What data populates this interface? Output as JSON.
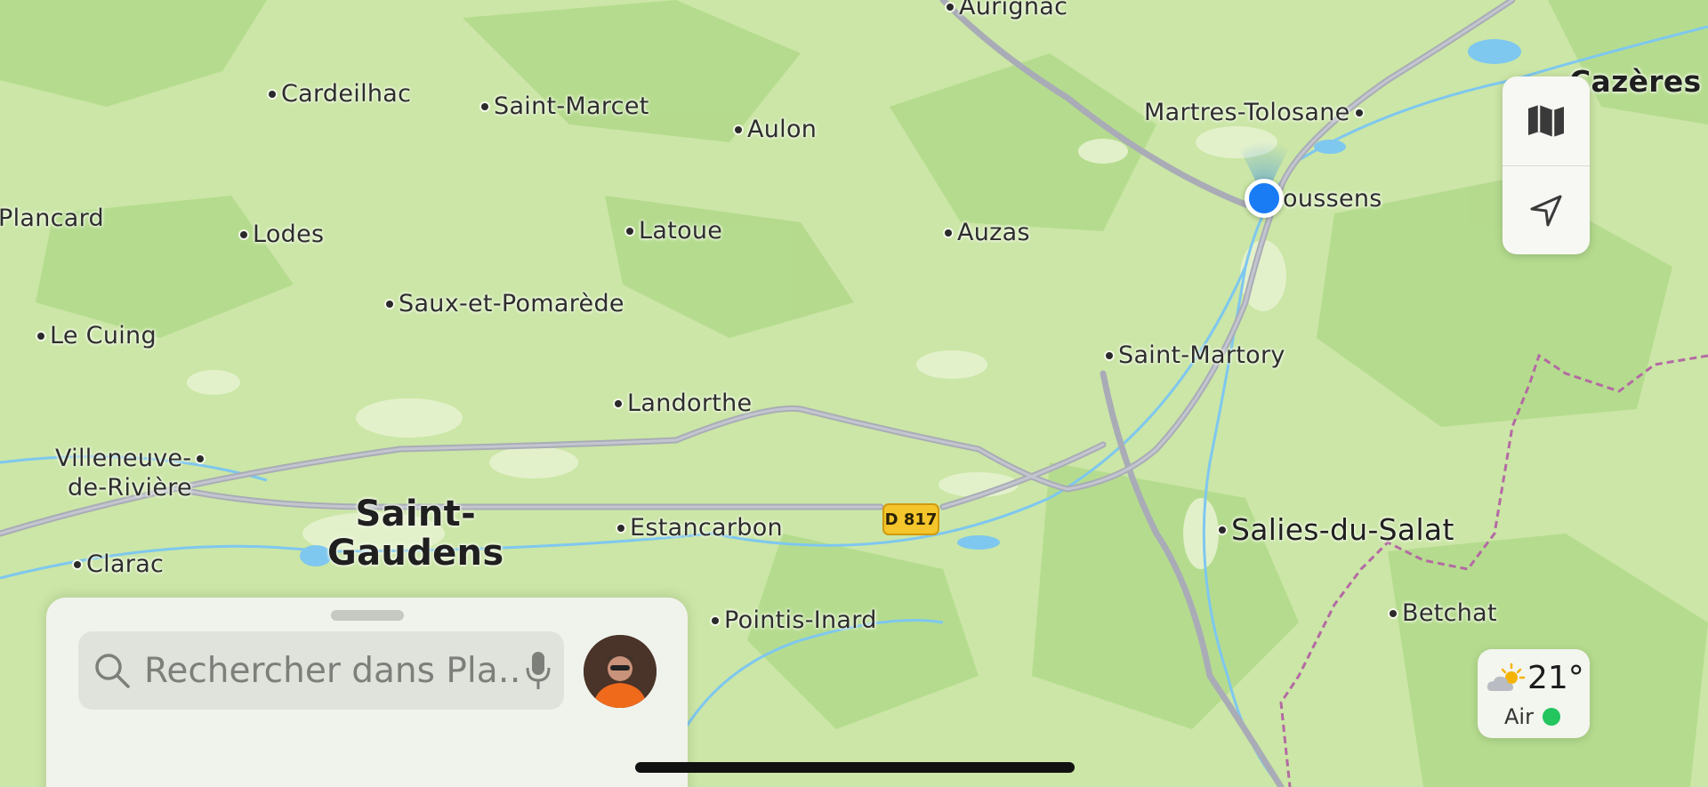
{
  "map": {
    "places": [
      {
        "id": "aurignac",
        "name": "Aurignac"
      },
      {
        "id": "cardeilhac",
        "name": "Cardeilhac"
      },
      {
        "id": "saint-marcet",
        "name": "Saint-Marcet"
      },
      {
        "id": "aulon",
        "name": "Aulon"
      },
      {
        "id": "martres-tolosane",
        "name": "Martres-Tolosane"
      },
      {
        "id": "cazeres",
        "name": "Cazères"
      },
      {
        "id": "plancard",
        "name": "Plancard"
      },
      {
        "id": "lodes",
        "name": "Lodes"
      },
      {
        "id": "latoue",
        "name": "Latoue"
      },
      {
        "id": "auzas",
        "name": "Auzas"
      },
      {
        "id": "boussens",
        "name": "oussens"
      },
      {
        "id": "saux-et-pomarede",
        "name": "Saux-et-Pomarède"
      },
      {
        "id": "le-cuing",
        "name": "Le Cuing"
      },
      {
        "id": "saint-martory",
        "name": "Saint-Martory"
      },
      {
        "id": "landorthe",
        "name": "Landorthe"
      },
      {
        "id": "villeneuve-1",
        "name": "Villeneuve-"
      },
      {
        "id": "villeneuve-2",
        "name": "de-Rivière"
      },
      {
        "id": "saint-gaudens-1",
        "name": "Saint-"
      },
      {
        "id": "saint-gaudens-2",
        "name": "Gaudens"
      },
      {
        "id": "estancarbon",
        "name": "Estancarbon"
      },
      {
        "id": "salies-du-salat",
        "name": "Salies-du-Salat"
      },
      {
        "id": "clarac",
        "name": "Clarac"
      },
      {
        "id": "pointis-inard",
        "name": "Pointis-Inard"
      },
      {
        "id": "betchat",
        "name": "Betchat"
      }
    ],
    "route_shield": "D 817"
  },
  "controls": {
    "map_mode_icon": "map-icon",
    "locate_icon": "location-arrow-icon"
  },
  "weather": {
    "icon": "partly-cloudy-sun-icon",
    "temperature": "21°",
    "air_label": "Air",
    "air_quality_color": "#22c55e"
  },
  "search": {
    "placeholder": "Rechercher dans Pla…",
    "search_icon": "search-icon",
    "mic_icon": "microphone-icon"
  },
  "colors": {
    "user_location": "#1a7cf5",
    "route_shield": "#f5c62b"
  }
}
